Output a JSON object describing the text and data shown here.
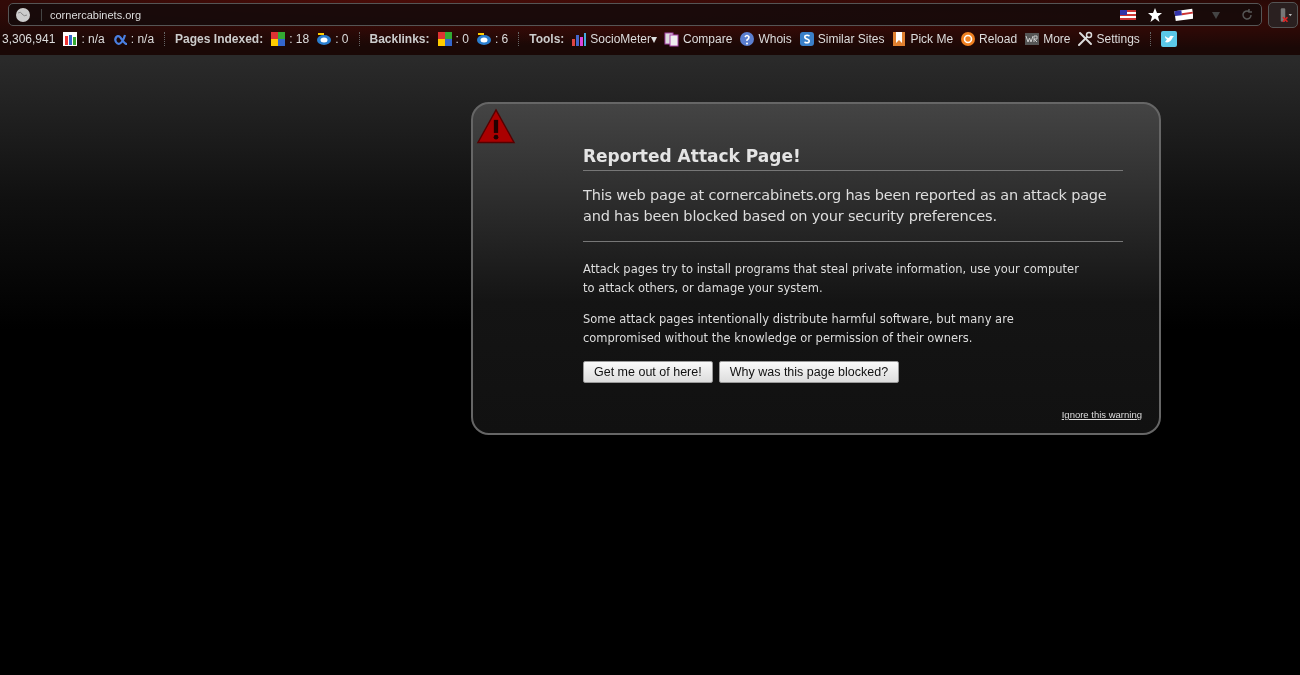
{
  "address_bar": {
    "url": "cornercabinets.org"
  },
  "seo_toolbar": {
    "groups": [
      {
        "items": [
          {
            "text": "3,306,941"
          },
          {
            "text": ": n/a"
          },
          {
            "text": ": n/a"
          }
        ]
      },
      {
        "label": "Pages Indexed:",
        "items": [
          {
            "text": ": 18"
          },
          {
            "text": ": 0"
          }
        ]
      },
      {
        "label": "Backlinks:",
        "items": [
          {
            "text": ": 0"
          },
          {
            "text": ": 6"
          }
        ]
      },
      {
        "label": "Tools:",
        "items": [
          {
            "text": "SocioMeter▾"
          },
          {
            "text": "Compare"
          },
          {
            "text": "Whois"
          },
          {
            "text": "Similar Sites"
          },
          {
            "text": "Pick Me"
          },
          {
            "text": "Reload"
          },
          {
            "text": "More"
          },
          {
            "text": "Settings"
          }
        ]
      }
    ]
  },
  "warning": {
    "title": "Reported Attack Page!",
    "lead": "This web page at cornercabinets.org has been reported as an attack page and has been blocked based on your security preferences.",
    "paragraphs": [
      "Attack pages try to install programs that steal private information, use your computer to attack others, or damage your system.",
      "Some attack pages intentionally distribute harmful software, but many are compromised without the knowledge or permission of their owners."
    ],
    "buttons": [
      "Get me out of here!",
      "Why was this page blocked?"
    ],
    "ignore_link": "Ignore this warning"
  }
}
